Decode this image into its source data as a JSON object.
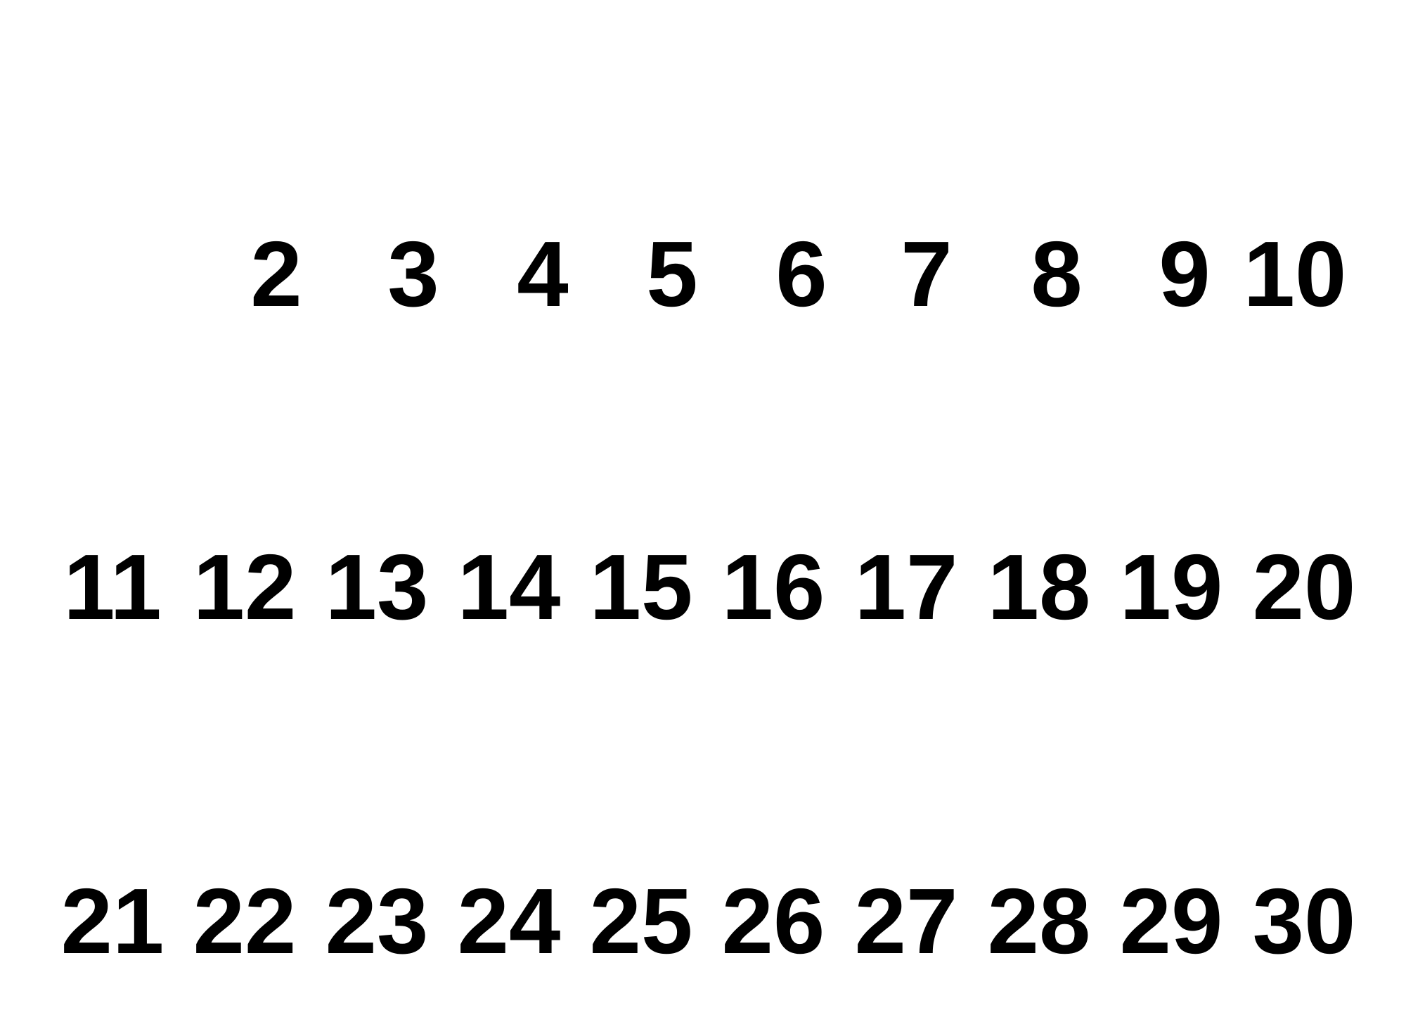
{
  "rows": [
    [
      "2",
      "3",
      "4",
      "5",
      "6",
      "7",
      "8",
      "9",
      "10"
    ],
    [
      "11",
      "12",
      "13",
      "14",
      "15",
      "16",
      "17",
      "18",
      "19",
      "20"
    ],
    [
      "21",
      "22",
      "23",
      "24",
      "25",
      "26",
      "27",
      "28",
      "29",
      "30"
    ]
  ],
  "colors": {
    "text": "#000000",
    "background": "#ffffff"
  }
}
